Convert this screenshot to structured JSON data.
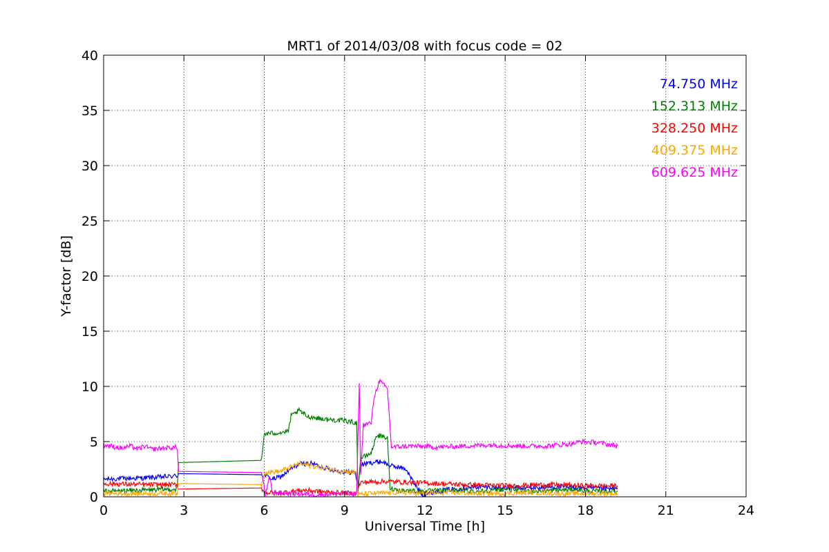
{
  "chart_data": {
    "type": "line",
    "title": "MRT1 of 2014/03/08 with focus code = 02",
    "xlabel": "Universal Time [h]",
    "ylabel": "Y-factor [dB]",
    "xlim": [
      0,
      24
    ],
    "ylim": [
      0,
      40
    ],
    "xticks": [
      0,
      3,
      6,
      9,
      12,
      15,
      18,
      21,
      24
    ],
    "yticks": [
      0,
      5,
      10,
      15,
      20,
      25,
      30,
      35,
      40
    ],
    "grid": true,
    "legend_position": "top-right",
    "series": [
      {
        "name": "74.750 MHz",
        "color": "#0000ff",
        "points": [
          [
            0,
            1.6
          ],
          [
            1.4,
            1.7
          ],
          [
            2.2,
            1.8
          ],
          [
            2.75,
            1.9
          ],
          [
            2.8,
            2.1
          ],
          [
            5.9,
            2.0
          ],
          [
            6.05,
            1.9
          ],
          [
            6.3,
            1.6
          ],
          [
            6.6,
            1.8
          ],
          [
            7.0,
            2.5
          ],
          [
            7.3,
            3.0
          ],
          [
            7.8,
            3.0
          ],
          [
            8.3,
            2.6
          ],
          [
            8.8,
            2.3
          ],
          [
            9.4,
            2.2
          ],
          [
            9.5,
            1.0
          ],
          [
            9.6,
            2.9
          ],
          [
            10.0,
            3.1
          ],
          [
            10.4,
            3.2
          ],
          [
            10.7,
            2.8
          ],
          [
            11.0,
            2.7
          ],
          [
            11.3,
            2.5
          ],
          [
            11.6,
            1.2
          ],
          [
            11.9,
            0.2
          ],
          [
            12.5,
            0.5
          ],
          [
            13.0,
            0.7
          ],
          [
            14.0,
            0.9
          ],
          [
            15.0,
            0.8
          ],
          [
            16.0,
            0.8
          ],
          [
            17.0,
            0.9
          ],
          [
            18.0,
            0.8
          ],
          [
            19.2,
            0.7
          ]
        ]
      },
      {
        "name": "152.313 MHz",
        "color": "#008000",
        "points": [
          [
            0,
            0.5
          ],
          [
            1.5,
            0.6
          ],
          [
            2.75,
            0.7
          ],
          [
            2.8,
            3.1
          ],
          [
            5.9,
            3.3
          ],
          [
            6.0,
            5.7
          ],
          [
            6.5,
            5.8
          ],
          [
            6.9,
            5.9
          ],
          [
            7.0,
            7.3
          ],
          [
            7.3,
            7.8
          ],
          [
            7.6,
            7.3
          ],
          [
            8.3,
            7.0
          ],
          [
            9.0,
            6.9
          ],
          [
            9.45,
            6.7
          ],
          [
            9.5,
            0.5
          ],
          [
            9.6,
            3.5
          ],
          [
            9.8,
            3.7
          ],
          [
            10.0,
            4.0
          ],
          [
            10.2,
            5.6
          ],
          [
            10.6,
            5.3
          ],
          [
            10.7,
            0.8
          ],
          [
            11.0,
            0.6
          ],
          [
            12.0,
            0.5
          ],
          [
            13.0,
            0.6
          ],
          [
            14.0,
            0.5
          ],
          [
            15.0,
            0.7
          ],
          [
            16.0,
            0.5
          ],
          [
            17.0,
            0.6
          ],
          [
            17.7,
            0.7
          ],
          [
            18.0,
            0.5
          ],
          [
            19.2,
            0.5
          ]
        ]
      },
      {
        "name": "328.250 MHz",
        "color": "#ff0000",
        "points": [
          [
            0,
            1.2
          ],
          [
            1.5,
            1.1
          ],
          [
            2.75,
            1.1
          ],
          [
            2.8,
            0.7
          ],
          [
            5.9,
            0.8
          ],
          [
            6.0,
            0.4
          ],
          [
            6.5,
            0.3
          ],
          [
            7.0,
            0.5
          ],
          [
            7.5,
            0.6
          ],
          [
            8.5,
            0.4
          ],
          [
            9.4,
            0.3
          ],
          [
            9.6,
            1.3
          ],
          [
            10.5,
            1.4
          ],
          [
            11.5,
            1.3
          ],
          [
            12.5,
            1.2
          ],
          [
            13.5,
            1.1
          ],
          [
            15.0,
            1.0
          ],
          [
            16.5,
            1.1
          ],
          [
            18.0,
            1.0
          ],
          [
            19.2,
            1.0
          ]
        ]
      },
      {
        "name": "409.375 MHz",
        "color": "#ffa500",
        "points": [
          [
            0,
            0.3
          ],
          [
            1.5,
            0.3
          ],
          [
            2.75,
            0.3
          ],
          [
            2.8,
            1.2
          ],
          [
            5.9,
            1.1
          ],
          [
            6.0,
            2.2
          ],
          [
            6.6,
            2.3
          ],
          [
            7.0,
            2.7
          ],
          [
            7.3,
            3.0
          ],
          [
            8.0,
            2.7
          ],
          [
            9.0,
            2.3
          ],
          [
            9.45,
            2.2
          ],
          [
            9.5,
            0.2
          ],
          [
            10.0,
            0.3
          ],
          [
            11.0,
            0.4
          ],
          [
            12.0,
            0.3
          ],
          [
            13.0,
            0.4
          ],
          [
            14.0,
            0.3
          ],
          [
            15.0,
            0.3
          ],
          [
            16.0,
            0.4
          ],
          [
            17.0,
            0.3
          ],
          [
            18.0,
            0.3
          ],
          [
            19.2,
            0.3
          ]
        ]
      },
      {
        "name": "609.625 MHz",
        "color": "#ff00ff",
        "points": [
          [
            0,
            4.7
          ],
          [
            0.7,
            4.4
          ],
          [
            1.0,
            4.6
          ],
          [
            1.3,
            4.3
          ],
          [
            1.5,
            4.6
          ],
          [
            1.8,
            4.3
          ],
          [
            2.2,
            4.4
          ],
          [
            2.75,
            4.5
          ],
          [
            2.8,
            2.3
          ],
          [
            5.9,
            2.2
          ],
          [
            6.05,
            0.2
          ],
          [
            6.2,
            1.8
          ],
          [
            6.3,
            0.4
          ],
          [
            7.0,
            0.3
          ],
          [
            8.0,
            0.2
          ],
          [
            9.0,
            0.3
          ],
          [
            9.45,
            0.2
          ],
          [
            9.55,
            10.5
          ],
          [
            9.6,
            2.0
          ],
          [
            9.7,
            6.5
          ],
          [
            10.0,
            6.7
          ],
          [
            10.1,
            9.0
          ],
          [
            10.3,
            10.5
          ],
          [
            10.6,
            9.8
          ],
          [
            10.75,
            4.5
          ],
          [
            11.5,
            4.6
          ],
          [
            12.5,
            4.5
          ],
          [
            13.5,
            4.6
          ],
          [
            14.5,
            4.7
          ],
          [
            15.5,
            4.6
          ],
          [
            16.5,
            4.6
          ],
          [
            17.5,
            4.8
          ],
          [
            17.8,
            5.0
          ],
          [
            18.5,
            4.9
          ],
          [
            19.2,
            4.6
          ]
        ]
      }
    ]
  }
}
